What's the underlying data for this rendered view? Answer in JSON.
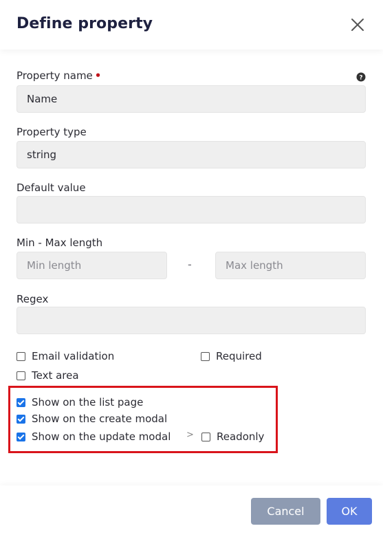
{
  "header": {
    "title": "Define property",
    "close_icon": "close-icon"
  },
  "form": {
    "property_name": {
      "label": "Property name",
      "required_marker": "•",
      "value": "Name"
    },
    "property_type": {
      "label": "Property type",
      "value": "string"
    },
    "default_value": {
      "label": "Default value",
      "value": ""
    },
    "min_max_length": {
      "label": "Min - Max length",
      "min_placeholder": "Min length",
      "separator": "-",
      "max_placeholder": "Max length"
    },
    "regex": {
      "label": "Regex",
      "value": ""
    }
  },
  "options": {
    "email_validation": {
      "label": "Email validation",
      "checked": false
    },
    "required": {
      "label": "Required",
      "checked": false
    },
    "text_area": {
      "label": "Text area",
      "checked": false
    },
    "show_list_page": {
      "label": "Show on the list page",
      "checked": true
    },
    "show_create_modal": {
      "label": "Show on the create modal",
      "checked": true
    },
    "show_update_modal": {
      "label": "Show on the update modal",
      "checked": true
    },
    "update_chevron": ">",
    "readonly": {
      "label": "Readonly",
      "checked": false
    }
  },
  "footer": {
    "cancel_label": "Cancel",
    "ok_label": "OK"
  },
  "colors": {
    "title": "#1e2140",
    "checkbox_checked": "#1a73e8",
    "highlight_border": "#d9141b",
    "cancel_button": "#8e9bb2",
    "ok_button": "#5c7de0",
    "input_background": "#efefef"
  }
}
